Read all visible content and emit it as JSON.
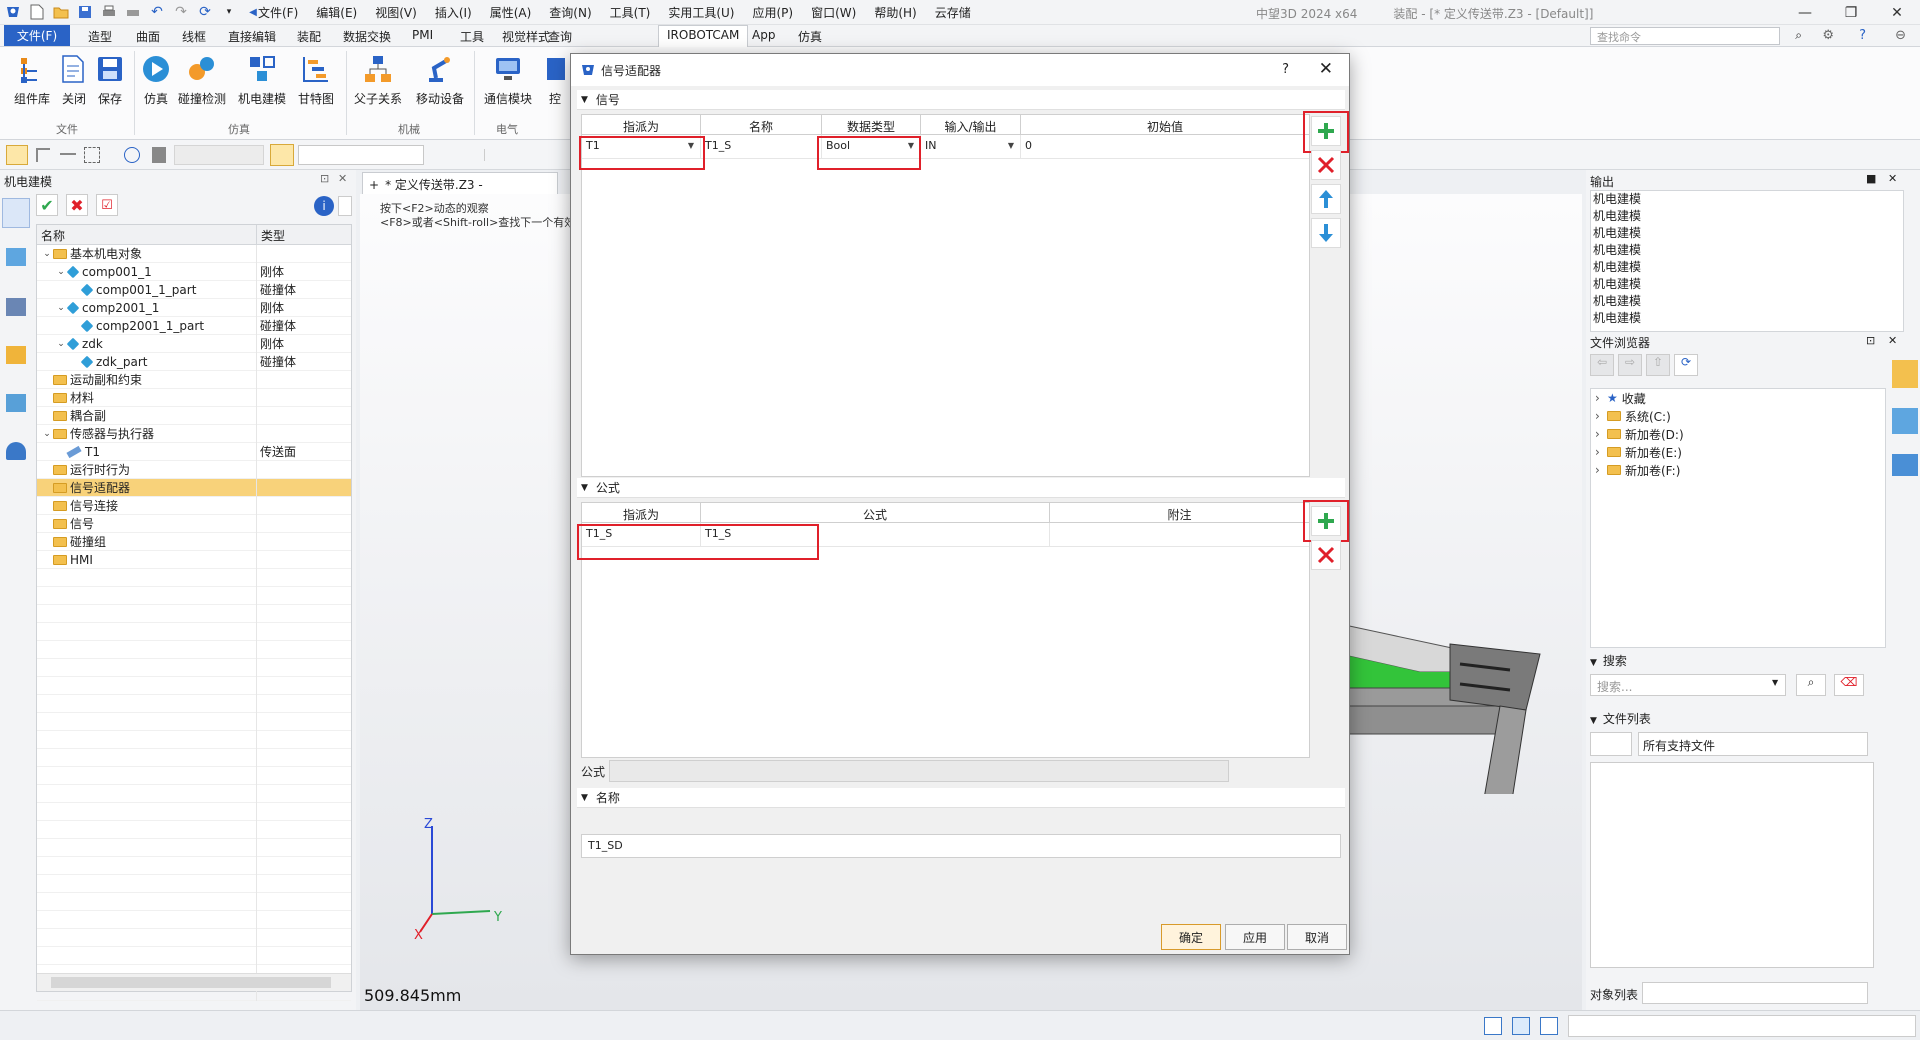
{
  "titlebar": {
    "menus": [
      "文件(F)",
      "编辑(E)",
      "视图(V)",
      "插入(I)",
      "属性(A)",
      "查询(N)",
      "工具(T)",
      "实用工具(U)",
      "应用(P)",
      "窗口(W)",
      "帮助(H)",
      "云存储"
    ],
    "app_name": "中望3D 2024 x64",
    "doc_title": "装配 - [* 定义传送带.Z3 - [Default]]"
  },
  "ribbon_tabs": {
    "file": "文件(F)",
    "items": [
      "造型",
      "曲面",
      "线框",
      "直接编辑",
      "装配",
      "数据交换",
      "PMI",
      "工具",
      "视觉样式",
      "查询"
    ],
    "active": "IROBOTCAM",
    "after": [
      "App",
      "仿真"
    ],
    "search_placeholder": "查找命令"
  },
  "ribbon": {
    "buttons": [
      "组件库",
      "关闭",
      "保存",
      "仿真",
      "碰撞检测",
      "机电建模",
      "甘特图",
      "父子关系",
      "移动设备",
      "通信模块",
      "控"
    ],
    "groups": [
      "文件",
      "仿真",
      "机械",
      "电气"
    ]
  },
  "left_panel": {
    "title": "机电建模",
    "tree_headers": [
      "名称",
      "类型"
    ],
    "tree_rows": [
      {
        "label": "基本机电对象",
        "type": "",
        "indent": 0,
        "icon": "folder",
        "toggle": "v"
      },
      {
        "label": "comp001_1",
        "type": "刚体",
        "indent": 1,
        "icon": "cube",
        "toggle": "v"
      },
      {
        "label": "comp001_1_part",
        "type": "碰撞体",
        "indent": 2,
        "icon": "cube",
        "toggle": ""
      },
      {
        "label": "comp2001_1",
        "type": "刚体",
        "indent": 1,
        "icon": "cube",
        "toggle": "v"
      },
      {
        "label": "comp2001_1_part",
        "type": "碰撞体",
        "indent": 2,
        "icon": "cube",
        "toggle": ""
      },
      {
        "label": "zdk",
        "type": "刚体",
        "indent": 1,
        "icon": "cube",
        "toggle": "v"
      },
      {
        "label": "zdk_part",
        "type": "碰撞体",
        "indent": 2,
        "icon": "cube",
        "toggle": ""
      },
      {
        "label": "运动副和约束",
        "type": "",
        "indent": 0,
        "icon": "folder",
        "toggle": ""
      },
      {
        "label": "材料",
        "type": "",
        "indent": 0,
        "icon": "folder",
        "toggle": ""
      },
      {
        "label": "耦合副",
        "type": "",
        "indent": 0,
        "icon": "folder",
        "toggle": ""
      },
      {
        "label": "传感器与执行器",
        "type": "",
        "indent": 0,
        "icon": "folder",
        "toggle": "v"
      },
      {
        "label": "T1",
        "type": "传送面",
        "indent": 1,
        "icon": "conveyor",
        "toggle": ""
      },
      {
        "label": "运行时行为",
        "type": "",
        "indent": 0,
        "icon": "folder",
        "toggle": ""
      },
      {
        "label": "信号适配器",
        "type": "",
        "indent": 0,
        "icon": "folder",
        "toggle": "",
        "selected": true
      },
      {
        "label": "信号连接",
        "type": "",
        "indent": 0,
        "icon": "folder",
        "toggle": ""
      },
      {
        "label": "信号",
        "type": "",
        "indent": 0,
        "icon": "folder",
        "toggle": ""
      },
      {
        "label": "碰撞组",
        "type": "",
        "indent": 0,
        "icon": "folder",
        "toggle": ""
      },
      {
        "label": "HMI",
        "type": "",
        "indent": 0,
        "icon": "folder",
        "toggle": ""
      }
    ]
  },
  "document_tab": "* 定义传送带.Z3 - [Default]",
  "viewport": {
    "hint1": "按下<F2>动态的观察",
    "hint2": "<F8>或者<Shift-roll>查找下一个有效",
    "measure": "509.845mm",
    "axis_z": "Z",
    "axis_y": "Y",
    "axis_x": "X"
  },
  "right_panel": {
    "output_title": "输出",
    "output_lines": [
      "机电建模",
      "机电建模",
      "机电建模",
      "机电建模",
      "机电建模",
      "机电建模",
      "机电建模",
      "机电建模"
    ],
    "browser_title": "文件浏览器",
    "browser_items": [
      "收藏",
      "系统(C:)",
      "新加卷(D:)",
      "新加卷(E:)",
      "新加卷(F:)"
    ],
    "search_title": "搜索",
    "search_placeholder": "搜索...",
    "filelist_title": "文件列表",
    "filelist_filter": "所有支持文件",
    "object_list_label": "对象列表"
  },
  "dialog": {
    "title": "信号适配器",
    "help": "?",
    "signal_section": "信号",
    "signal_headers": [
      "指派为",
      "名称",
      "数据类型",
      "输入/输出",
      "初始值"
    ],
    "signal_row": {
      "assign": "T1",
      "name": "T1_S",
      "datatype": "Bool",
      "io": "IN",
      "init": "0"
    },
    "formula_section": "公式",
    "formula_headers": [
      "指派为",
      "公式",
      "附注"
    ],
    "formula_row": {
      "assign": "T1_S",
      "formula": "T1_S",
      "note": ""
    },
    "formula_label": "公式",
    "name_section": "名称",
    "name_value": "T1_SD",
    "ok": "确定",
    "apply": "应用",
    "cancel": "取消"
  },
  "colors": {
    "accent": "#2a63c6",
    "highlight_red": "#e0202a",
    "selection": "#f8d27a",
    "plus_green": "#2fa84f"
  }
}
